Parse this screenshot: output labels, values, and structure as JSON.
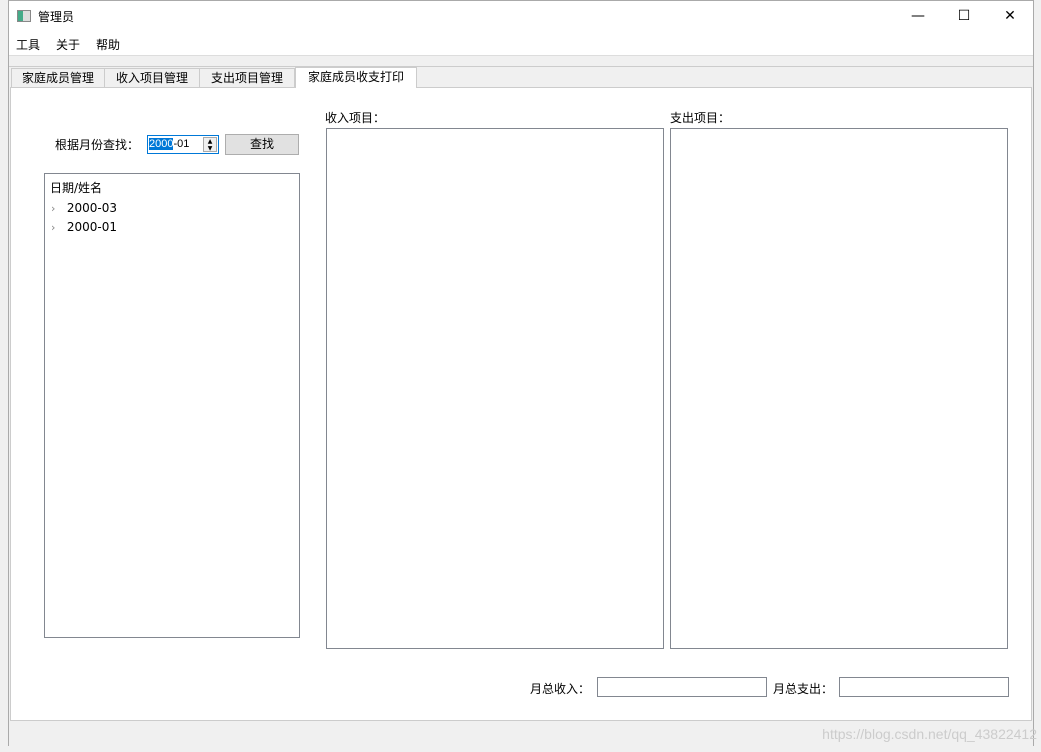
{
  "window": {
    "title": "管理员",
    "minimize": "—",
    "maximize": "☐",
    "close": "✕"
  },
  "menu": [
    "工具",
    "关于",
    "帮助"
  ],
  "tabs": [
    "家庭成员管理",
    "收入项目管理",
    "支出项目管理",
    "家庭成员收支打印"
  ],
  "search": {
    "label": "根据月份查找：",
    "value_selected": "2000",
    "value_rest": "-01",
    "button": "查找"
  },
  "tree": {
    "header": "日期/姓名",
    "items": [
      "2000-03",
      "2000-01"
    ]
  },
  "income": {
    "label": "收入项目："
  },
  "expense": {
    "label": "支出项目："
  },
  "totals": {
    "income_label": "月总收入：",
    "income_value": "",
    "expense_label": "月总支出：",
    "expense_value": ""
  },
  "watermark": "https://blog.csdn.net/qq_43822412"
}
